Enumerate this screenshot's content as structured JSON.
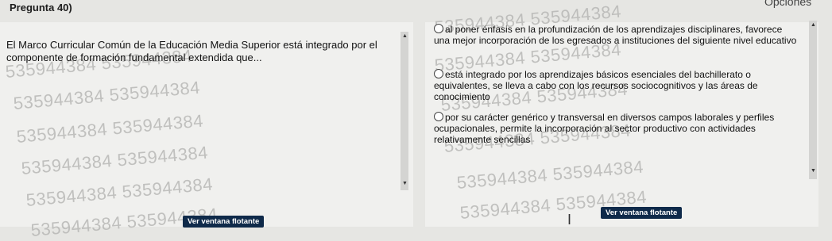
{
  "header": {
    "title": "Pregunta 40)",
    "options_label": "Opciones"
  },
  "question": {
    "text": "El Marco Curricular Común de la Educación Media Superior está integrado por el componente de formación fundamental extendida que..."
  },
  "options": [
    {
      "text": "al poner énfasis en la profundización de los aprendizajes disciplinares, favorece una mejor incorporación de los egresados a instituciones del siguiente nivel educativo"
    },
    {
      "text": "está integrado por los aprendizajes básicos esenciales del bachillerato o equivalentes, se lleva a cabo con los recursos sociocognitivos y las áreas de conocimiento"
    },
    {
      "text": "por su carácter genérico y transversal en diversos campos laborales y perfiles ocupacionales, permite la incorporación al sector productivo con actividades relativamente sencillas"
    }
  ],
  "watermark": {
    "text": "535944384 535944384"
  },
  "floating_windows": {
    "left_label": "Ver ventana flotante",
    "right_label": "Ver ventana flotante"
  }
}
